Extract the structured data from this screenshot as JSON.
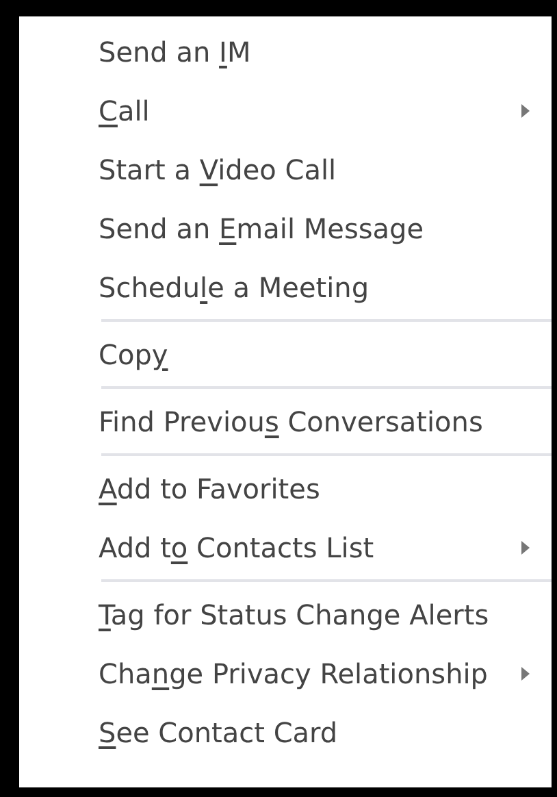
{
  "context_menu": {
    "items": [
      {
        "kind": "item",
        "before": "Send an ",
        "access_key": "I",
        "after": "M",
        "submenu": false
      },
      {
        "kind": "item",
        "access_key": "C",
        "after": "all",
        "submenu": true
      },
      {
        "kind": "item",
        "before": "Start a ",
        "access_key": "V",
        "after": "ideo Call",
        "submenu": false
      },
      {
        "kind": "item",
        "before": "Send an ",
        "access_key": "E",
        "after": "mail Message",
        "submenu": false
      },
      {
        "kind": "item",
        "before": "Schedu",
        "access_key": "l",
        "after": "e a Meeting",
        "submenu": false
      },
      {
        "kind": "separator"
      },
      {
        "kind": "item",
        "before": "Cop",
        "access_key": "y",
        "submenu": false
      },
      {
        "kind": "separator"
      },
      {
        "kind": "item",
        "before": "Find Previou",
        "access_key": "s",
        "after": " Conversations",
        "submenu": false
      },
      {
        "kind": "separator"
      },
      {
        "kind": "item",
        "access_key": "A",
        "after": "dd to Favorites",
        "submenu": false
      },
      {
        "kind": "item",
        "before": "Add t",
        "access_key": "o",
        "after": " Contacts List",
        "submenu": true
      },
      {
        "kind": "separator"
      },
      {
        "kind": "item",
        "access_key": "T",
        "after": "ag for Status Change Alerts",
        "submenu": false
      },
      {
        "kind": "item",
        "before": "Cha",
        "access_key": "n",
        "after": "ge Privacy Relationship",
        "submenu": true
      },
      {
        "kind": "item",
        "access_key": "S",
        "after": "ee Contact Card",
        "submenu": false
      }
    ]
  }
}
